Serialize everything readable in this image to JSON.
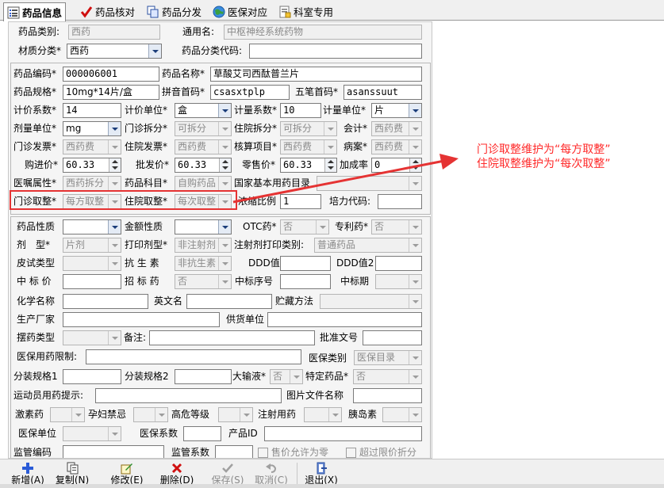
{
  "tabs": [
    {
      "label": "药品信息",
      "icon": "list-icon",
      "active": true
    },
    {
      "label": "药品核对",
      "icon": "checkmark-icon",
      "active": false
    },
    {
      "label": "药品分发",
      "icon": "copy-icon",
      "active": false
    },
    {
      "label": "医保对应",
      "icon": "globe-icon",
      "active": false
    },
    {
      "label": "科室专用",
      "icon": "note-icon",
      "active": false
    }
  ],
  "top": {
    "category_label": "药品类别:",
    "category_value": "西药",
    "generic_label": "通用名:",
    "generic_value": "中枢神经系统药物",
    "material_label": "材质分类*",
    "material_value": "西药",
    "classcode_label": "药品分类代码:",
    "classcode_value": ""
  },
  "basic": {
    "code_label": "药品编码*",
    "code_value": "000006001",
    "name_label": "药品名称*",
    "name_value": "草酸艾司西酞普兰片",
    "spec_label": "药品规格*",
    "spec_value": "10mg*14片/盒",
    "pinyin_label": "拼音首码*",
    "pinyin_value": "csasxtplp",
    "wubi_label": "五笔首码*",
    "wubi_value": "asanssuut",
    "price_coef_label": "计价系数*",
    "price_coef_value": "14",
    "price_unit_label": "计价单位*",
    "price_unit_value": "盒",
    "dose_coef_label": "计量系数*",
    "dose_coef_value": "10",
    "dose_unit_label": "计量单位*",
    "dose_unit_value": "片",
    "agent_unit_label": "剂量单位*",
    "agent_unit_value": "mg",
    "op_split_label": "门诊拆分*",
    "op_split_value": "可拆分",
    "ip_split_label": "住院拆分*",
    "ip_split_value": "可拆分",
    "account_label": "会计*",
    "account_value": "西药费",
    "op_invoice_label": "门诊发票*",
    "op_invoice_value": "西药费",
    "ip_invoice_label": "住院发票*",
    "ip_invoice_value": "西药费",
    "audit_item_label": "核算项目*",
    "audit_item_value": "西药费",
    "case_label": "病案*",
    "case_value": "西药费",
    "purchase_label": "购进价*",
    "purchase_value": "60.33",
    "wholesale_label": "批发价*",
    "wholesale_value": "60.33",
    "retail_label": "零售价*",
    "retail_value": "60.33",
    "markup_label": "加成率",
    "markup_value": "0",
    "attr_label": "医嘱属性*",
    "attr_value": "西药拆分",
    "subject_label": "药品科目*",
    "subject_value": "自购药品",
    "national_label": "国家基本用药目录",
    "national_value": "",
    "op_round_label": "门诊取整*",
    "op_round_value": "每方取整",
    "ip_round_label": "住院取整*",
    "ip_round_value": "每次取整",
    "concentration_label": "浓缩比例",
    "concentration_value": "1",
    "training_label": "培力代码:",
    "training_value": ""
  },
  "extra": {
    "nature_label": "药品性质",
    "nature_value": "",
    "amount_label": "金额性质",
    "amount_value": "",
    "otc_label": "OTC药*",
    "otc_value": "否",
    "patent_label": "专利药*",
    "patent_value": "否",
    "form_label": "剂　型*",
    "form_value": "片剂",
    "print_form_label": "打印剂型*",
    "print_form_value": "非注射剂",
    "inj_print_label": "注射剂打印类别:",
    "inj_print_value": "普通药品",
    "skin_label": "皮试类型",
    "skin_value": "",
    "anti_label": "抗 生 素",
    "anti_value": "非抗生素",
    "ddd_label": "DDD值",
    "ddd_value": "",
    "ddd2_label": "DDD值2",
    "ddd2_value": "",
    "bid_price_label": "中 标 价",
    "bid_price_value": "",
    "tender_label": "招 标 药",
    "tender_value": "否",
    "bid_no_label": "中标序号",
    "bid_no_value": "",
    "bid_period_label": "中标期",
    "bid_period_value": "",
    "chem_label": "化学名称",
    "chem_value": "",
    "en_label": "英文名",
    "en_value": "",
    "storage_label": "贮藏方法",
    "storage_value": "",
    "maker_label": "生产厂家",
    "maker_value": "",
    "supplier_label": "供货单位",
    "supplier_value": "",
    "placement_label": "摆药类型",
    "placement_value": "",
    "remark_label": "备注:",
    "remark_value": "",
    "approval_label": "批准文号",
    "approval_value": "",
    "ins_limit_label": "医保用药限制:",
    "ins_limit_value": "",
    "ins_class_label": "医保类别",
    "ins_class_value": "医保目录",
    "pack1_label": "分装规格1",
    "pack1_value": "",
    "pack2_label": "分装规格2",
    "pack2_value": "",
    "infusion_label": "大输液*",
    "infusion_value": "否",
    "special_label": "特定药品*",
    "special_value": "否",
    "athlete_label": "运动员用药提示:",
    "athlete_value": "",
    "image_label": "图片文件名称",
    "image_value": "",
    "hormone_label": "激素药",
    "hormone_value": "",
    "pregnancy_label": "孕妇禁忌",
    "pregnancy_value": "",
    "risk_label": "高危等级",
    "risk_value": "",
    "injection_label": "注射用药",
    "injection_value": "",
    "insulin_label": "胰岛素",
    "insulin_value": "",
    "ins_unit_label": "医保单位",
    "ins_unit_value": "",
    "ins_coef_label": "医保系数",
    "ins_coef_value": "",
    "product_id_label": "产品ID",
    "product_id_value": "",
    "cut_a": "监管编码",
    "cut_b": "监管系数",
    "cut_c": "售价允许为零",
    "cut_d": "超过限价折分"
  },
  "toolbar": [
    {
      "label": "新增(A)",
      "icon": "plus-icon",
      "enabled": true
    },
    {
      "label": "复制(N)",
      "icon": "copy-icon",
      "enabled": true
    },
    {
      "label": "修改(E)",
      "icon": "edit-icon",
      "enabled": true
    },
    {
      "label": "删除(D)",
      "icon": "delete-icon",
      "enabled": true
    },
    {
      "label": "保存(S)",
      "icon": "save-check-icon",
      "enabled": false
    },
    {
      "label": "取消(C)",
      "icon": "undo-icon",
      "enabled": false
    },
    {
      "label": "退出(X)",
      "icon": "exit-icon",
      "enabled": true
    }
  ],
  "annotation": {
    "line1": "门诊取整维护为“每方取整”",
    "line2": "住院取整维护为“每次取整”",
    "color": "#ff2a2a"
  }
}
